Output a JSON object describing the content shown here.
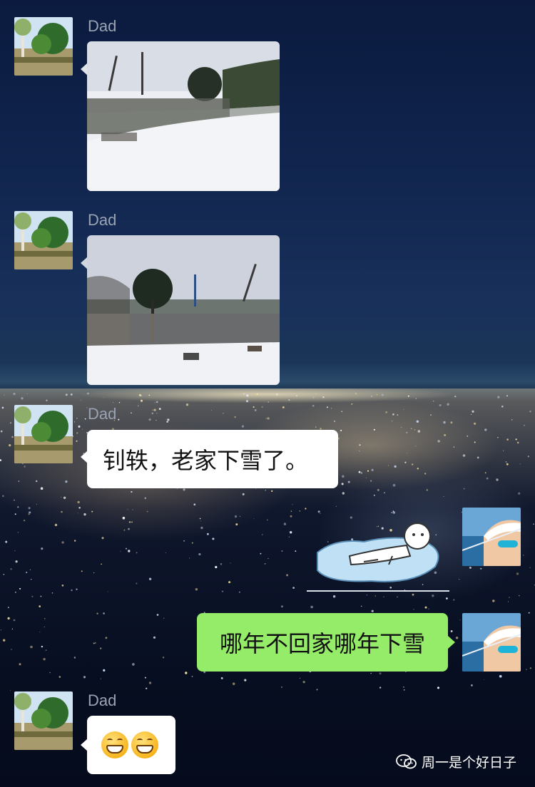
{
  "chat": {
    "messages": [
      {
        "type": "image",
        "sender": "Dad",
        "side": "left",
        "description": "snow-covered garden"
      },
      {
        "type": "image",
        "sender": "Dad",
        "side": "left",
        "description": "snowy yard with tree"
      },
      {
        "type": "text",
        "sender": "Dad",
        "side": "left",
        "text": "钊轶，老家下雪了。"
      },
      {
        "type": "sticker",
        "side": "right",
        "description": "melting-character-sticker"
      },
      {
        "type": "text",
        "side": "right",
        "text": "哪年不回家哪年下雪"
      },
      {
        "type": "emoji",
        "sender": "Dad",
        "side": "left",
        "emojis": [
          "grin-emoji",
          "grin-emoji"
        ]
      }
    ]
  },
  "watermark": {
    "text": "周一是个好日子",
    "icon": "wechat-icon"
  },
  "colors": {
    "green_bubble": "#95ec69",
    "white_bubble": "#ffffff",
    "sender_name": "#9aa3b3"
  }
}
